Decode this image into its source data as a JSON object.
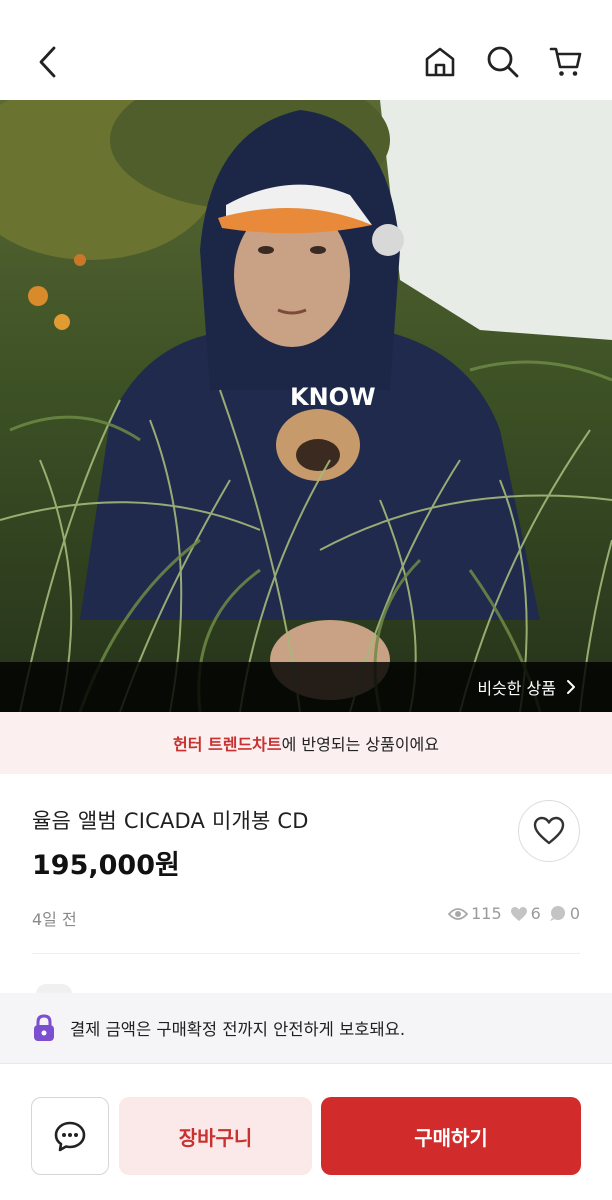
{
  "header": {
    "back_icon": "chevron-left-icon",
    "home_icon": "home-icon",
    "search_icon": "search-icon",
    "cart_icon": "cart-icon"
  },
  "hero": {
    "similar_label": "비슷한 상품",
    "shirt_text": "KNOW"
  },
  "notice": {
    "highlight": "헌터 트렌드차트",
    "rest": "에 반영되는 상품이에요"
  },
  "product": {
    "title": "율음 앨범  CICADA 미개봉 CD",
    "price": "195,000원",
    "posted": "4일 전",
    "views": "115",
    "likes": "6",
    "comments": "0"
  },
  "secure": {
    "message": "결제 금액은 구매확정 전까지 안전하게 보호돼요."
  },
  "bottom_bar": {
    "cart_label": "장바구니",
    "buy_label": "구매하기"
  },
  "colors": {
    "accent": "#d22b2b",
    "accent_soft": "#fbe9e9",
    "notice_bg": "#fbefef",
    "lock": "#7b4fd0"
  }
}
